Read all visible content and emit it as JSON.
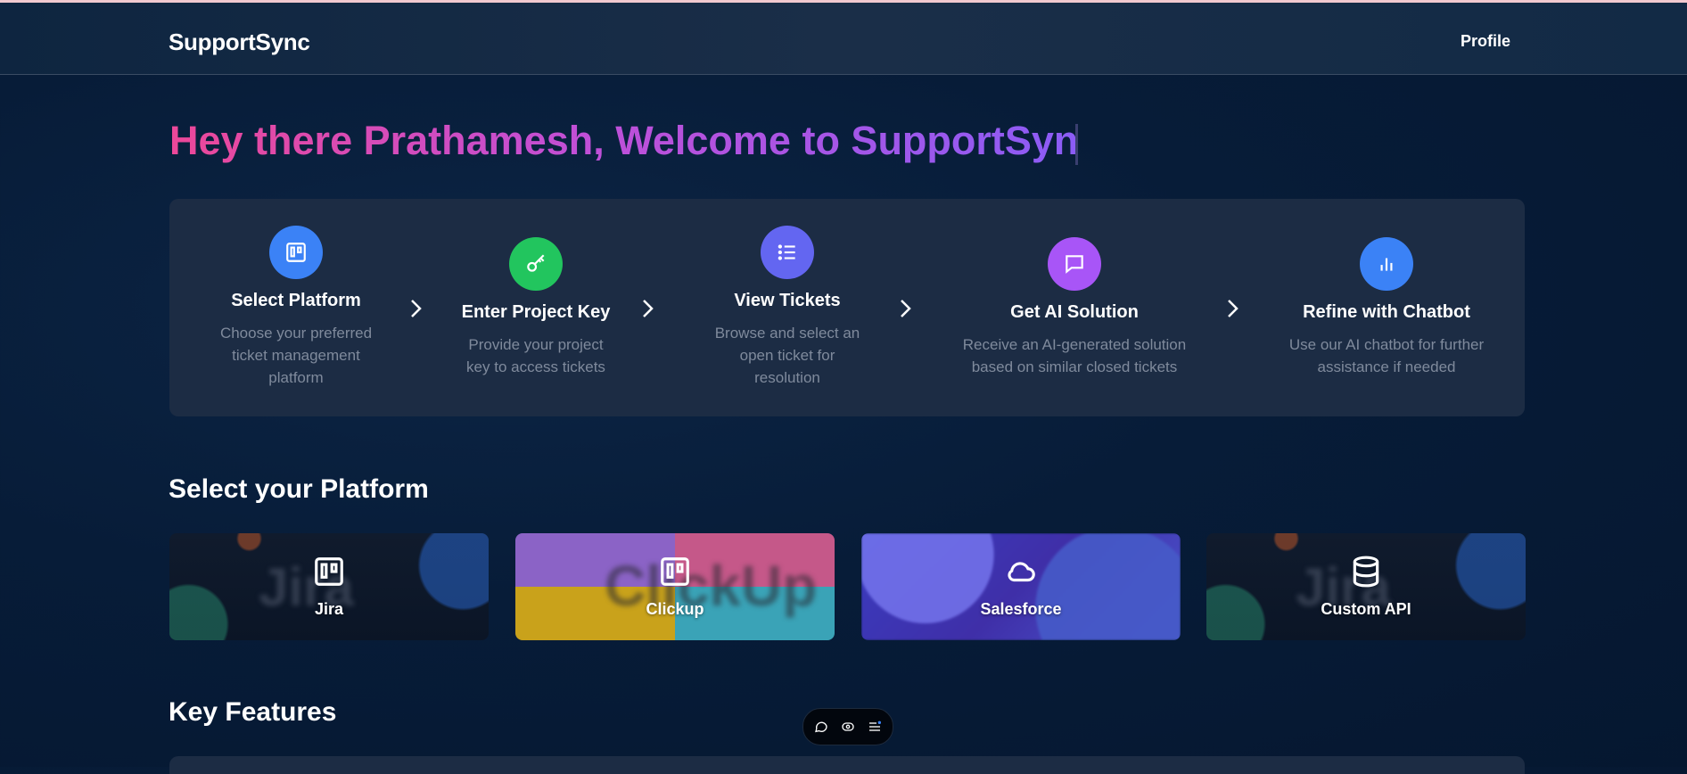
{
  "navbar": {
    "brand": "SupportSync",
    "profile_label": "Profile"
  },
  "hero": {
    "welcome_text": "Hey there Prathamesh, Welcome to SupportSyn"
  },
  "steps": [
    {
      "title": "Select Platform",
      "description": "Choose your preferred ticket management platform",
      "icon": "board-icon",
      "color": "#3b82f6"
    },
    {
      "title": "Enter Project Key",
      "description": "Provide your project key to access tickets",
      "icon": "key-icon",
      "color": "#22c55e"
    },
    {
      "title": "View Tickets",
      "description": "Browse and select an open ticket for resolution",
      "icon": "list-icon",
      "color": "#6366f1"
    },
    {
      "title": "Get AI Solution",
      "description": "Receive an AI-generated solution based on similar closed tickets",
      "icon": "chat-icon",
      "color": "#a855f7"
    },
    {
      "title": "Refine with Chatbot",
      "description": "Use our AI chatbot for further assistance if needed",
      "icon": "bar-chart-icon",
      "color": "#3b82f6"
    }
  ],
  "platform_section": {
    "title": "Select your Platform"
  },
  "platforms": [
    {
      "label": "Jira",
      "icon": "board-icon"
    },
    {
      "label": "Clickup",
      "icon": "board-icon"
    },
    {
      "label": "Salesforce",
      "icon": "cloud-icon"
    },
    {
      "label": "Custom API",
      "icon": "database-icon"
    }
  ],
  "features_section": {
    "title": "Key Features"
  },
  "toolbar": {
    "icons": [
      "chat-icon",
      "eye-icon",
      "menu-icon"
    ]
  }
}
